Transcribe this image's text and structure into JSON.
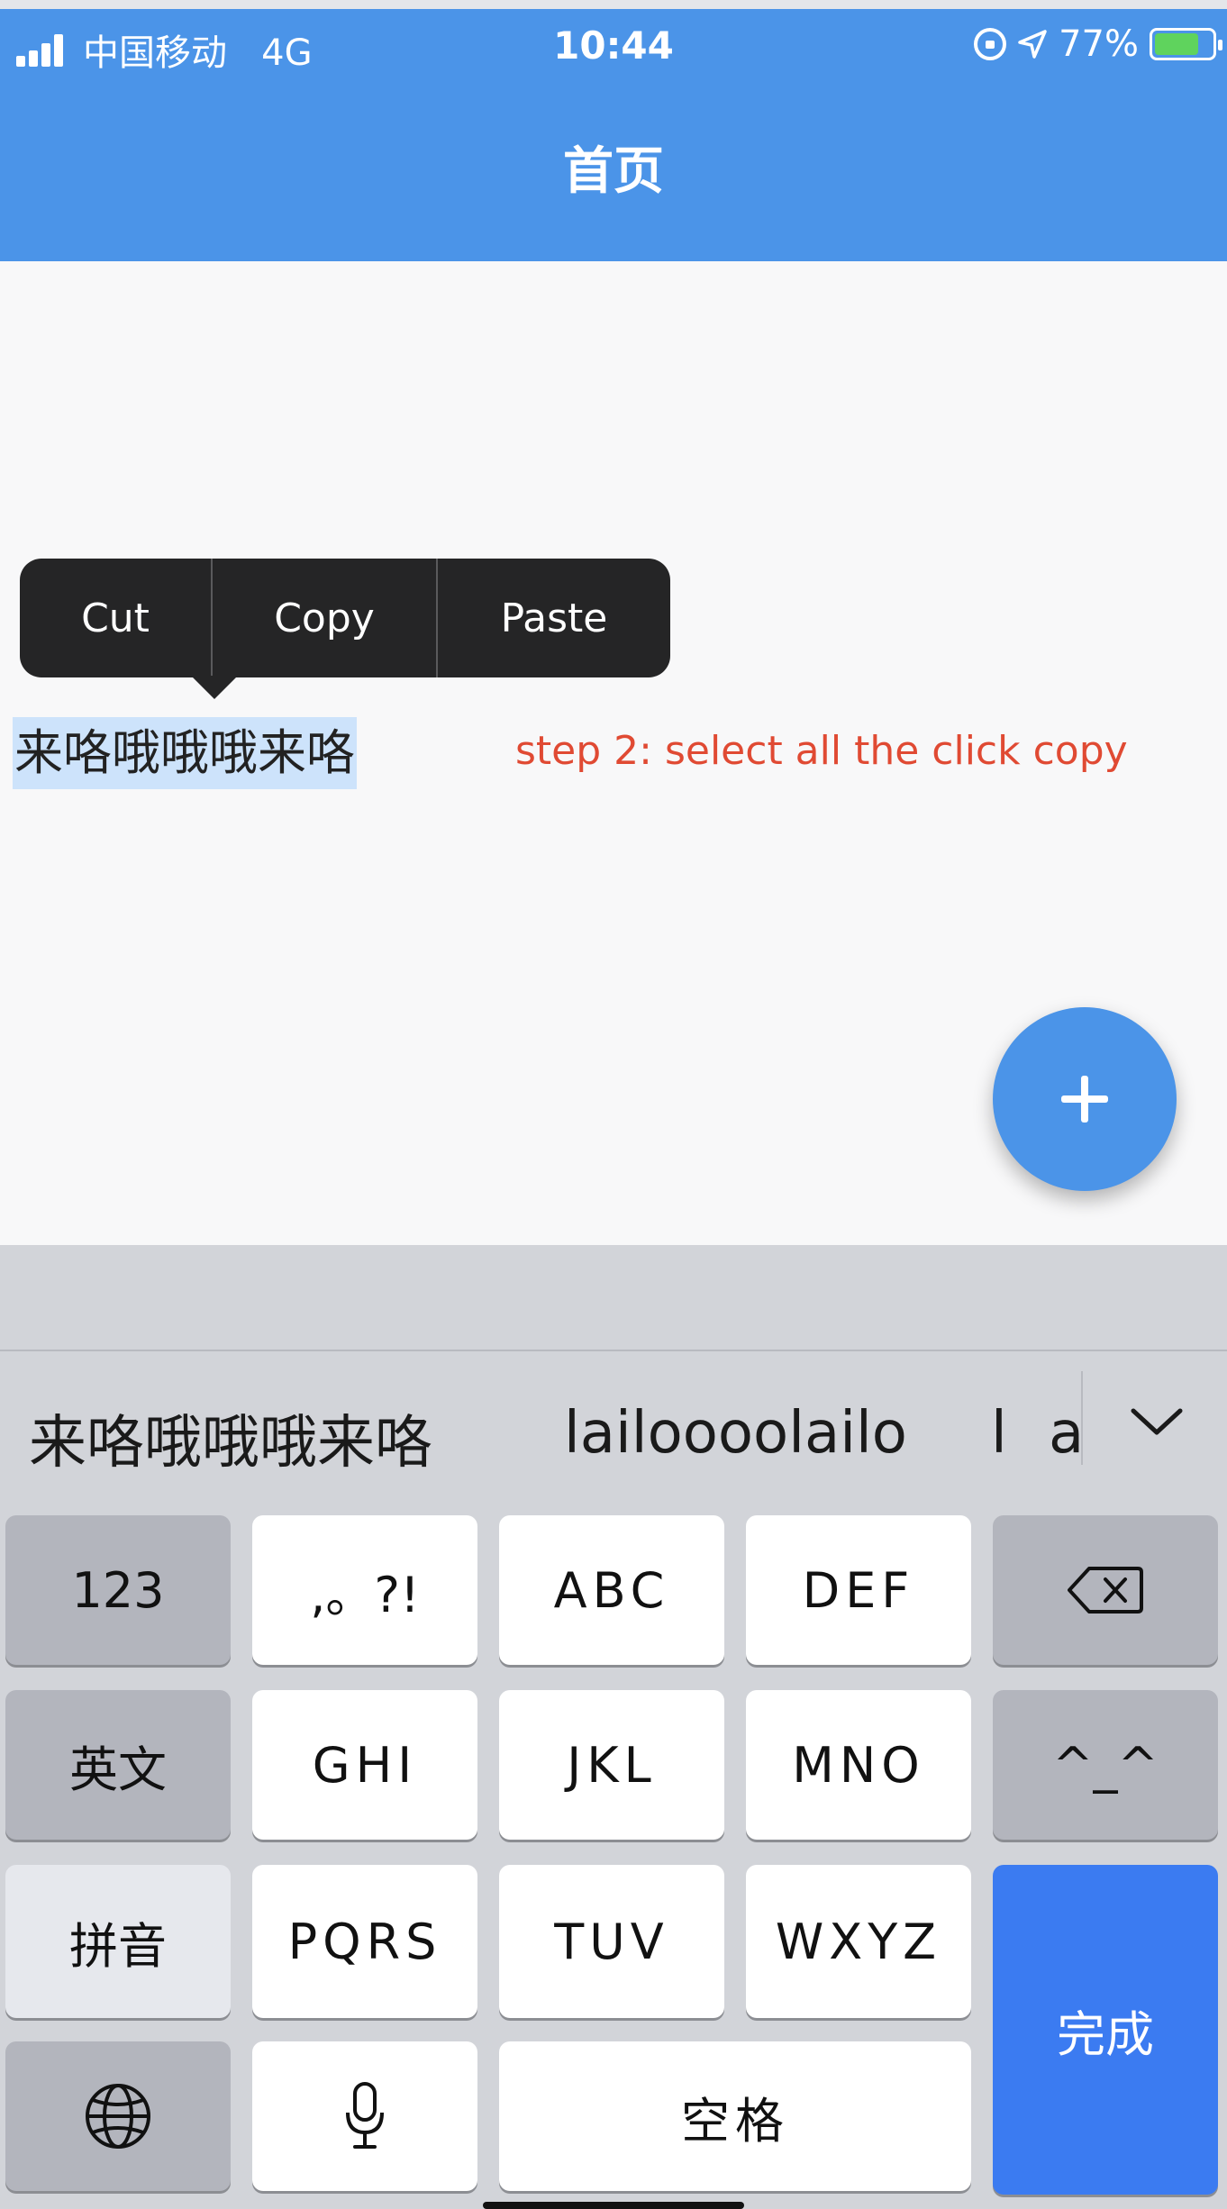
{
  "status_bar": {
    "carrier": "中国移动",
    "network": "4G",
    "time": "10:44",
    "battery": "77%",
    "battery_level": 0.77
  },
  "header": {
    "title": "首页"
  },
  "context_menu": {
    "cut": "Cut",
    "copy": "Copy",
    "paste": "Paste"
  },
  "content": {
    "selected_text": "来咯哦哦哦来咯",
    "annotation": "step 2: select all the click copy"
  },
  "fab": {
    "icon": "plus-icon"
  },
  "keyboard": {
    "candidates": [
      "来咯哦哦哦来咯",
      "lailoooolailo",
      "l",
      "a"
    ],
    "rows": [
      [
        "123",
        ",。?!",
        "ABC",
        "DEF",
        "delete"
      ],
      [
        "英文",
        "GHI",
        "JKL",
        "MNO",
        "^_^"
      ],
      [
        "拼音",
        "PQRS",
        "TUV",
        "WXYZ"
      ],
      [
        "globe",
        "mic",
        "空格"
      ]
    ],
    "done": "完成",
    "colors": {
      "done": "#3b7bf1",
      "header": "#4b94e8"
    }
  }
}
